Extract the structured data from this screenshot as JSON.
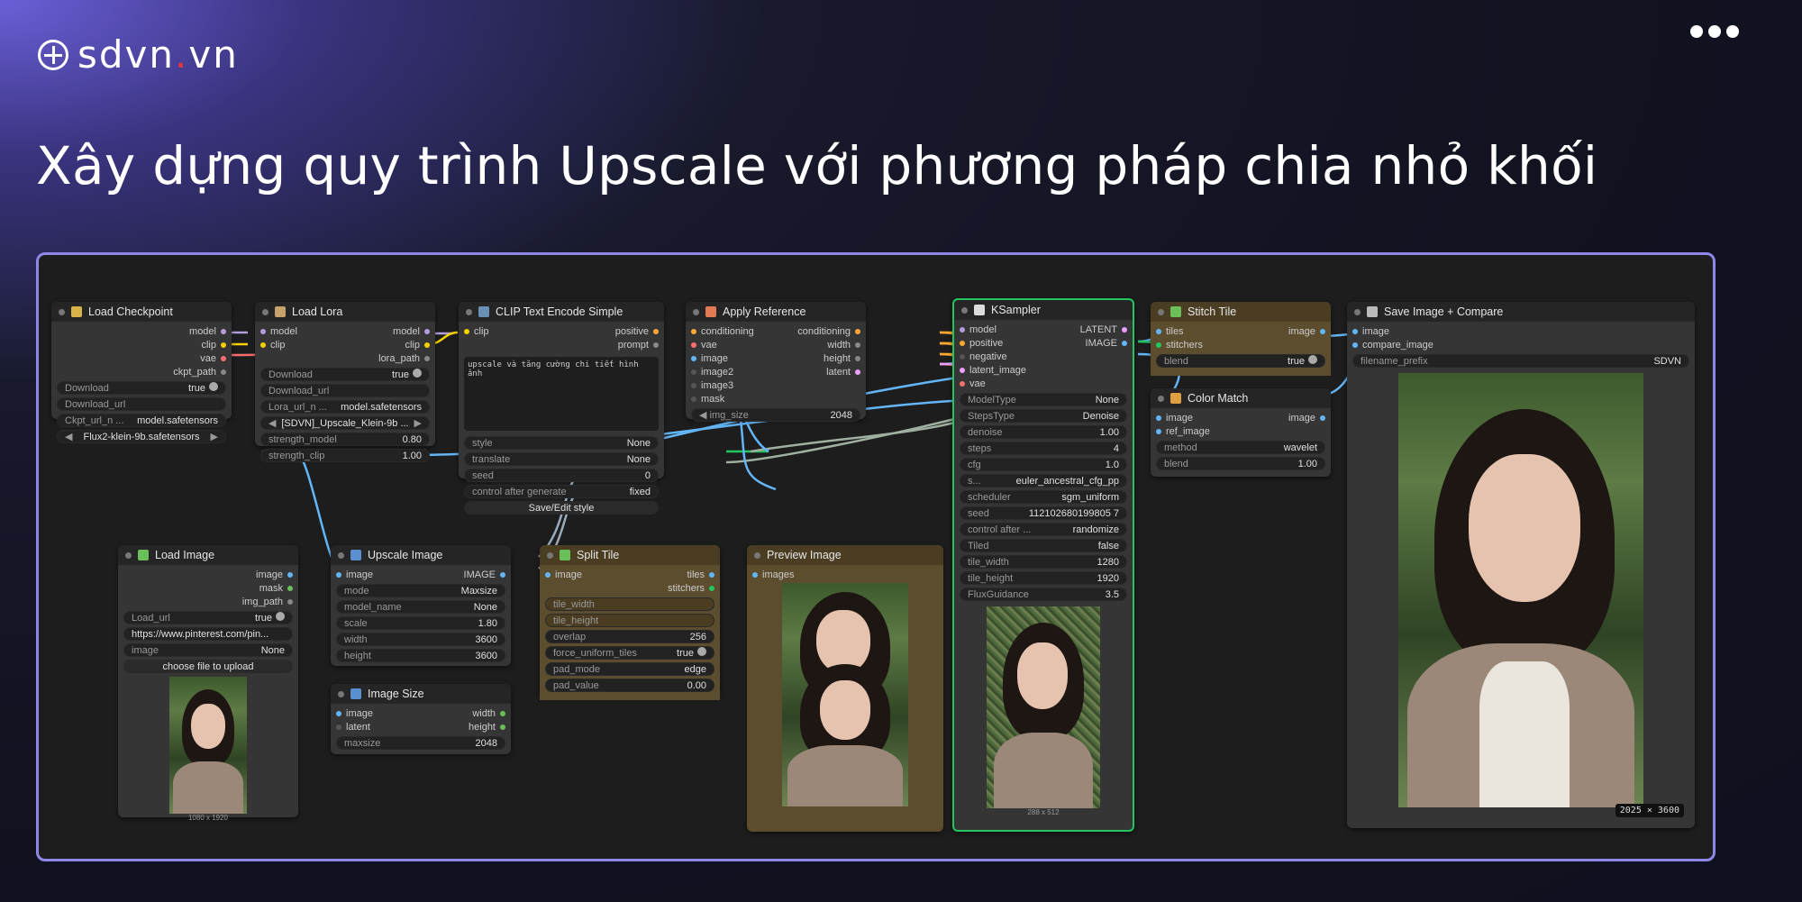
{
  "brand": {
    "name": "sdvn",
    "dot": ".",
    "tld": "vn"
  },
  "headline": "Xây dựng quy trình Upscale với phương pháp chia nhỏ khối",
  "nodes": {
    "load_checkpoint": {
      "title": "Load Checkpoint",
      "outputs": [
        "model",
        "clip",
        "vae",
        "ckpt_path"
      ],
      "widgets": [
        {
          "label": "Download",
          "value": "true"
        },
        {
          "label": "Download_url",
          "value": ""
        },
        {
          "label": "Ckpt_url_n ...",
          "value": "model.safetensors"
        },
        {
          "label": "",
          "value": "Flux2-klein-9b.safetensors"
        }
      ]
    },
    "load_lora": {
      "title": "Load Lora",
      "inputs": [
        "model",
        "clip"
      ],
      "outputs": [
        "model",
        "clip",
        "lora_path"
      ],
      "widgets": [
        {
          "label": "Download",
          "value": "true"
        },
        {
          "label": "Download_url",
          "value": ""
        },
        {
          "label": "Lora_url_n ...",
          "value": "model.safetensors"
        },
        {
          "label": "",
          "value": "[SDVN]_Upscale_Klein-9b ..."
        },
        {
          "label": "strength_model",
          "value": "0.80"
        },
        {
          "label": "strength_clip",
          "value": "1.00"
        }
      ]
    },
    "clip_text": {
      "title": "CLIP Text Encode Simple",
      "inputs": [
        "clip"
      ],
      "outputs": [
        "positive",
        "prompt"
      ],
      "text": "upscale và tăng cường chi tiết hình ảnh",
      "widgets": [
        {
          "label": "style",
          "value": "None"
        },
        {
          "label": "translate",
          "value": "None"
        },
        {
          "label": "seed",
          "value": "0"
        },
        {
          "label": "control after generate",
          "value": "fixed"
        }
      ],
      "button": "Save/Edit style"
    },
    "apply_reference": {
      "title": "Apply Reference",
      "inputs": [
        "conditioning",
        "vae",
        "image",
        "image2",
        "image3",
        "mask"
      ],
      "outputs": [
        "conditioning",
        "width",
        "height",
        "latent"
      ],
      "widgets": [
        {
          "label": "img_size",
          "value": "2048"
        }
      ]
    },
    "ksampler": {
      "title": "KSampler",
      "inputs": [
        "model",
        "positive",
        "negative",
        "latent_image",
        "vae"
      ],
      "outputs": [
        "LATENT",
        "IMAGE"
      ],
      "widgets": [
        {
          "label": "ModelType",
          "value": "None"
        },
        {
          "label": "StepsType",
          "value": "Denoise"
        },
        {
          "label": "denoise",
          "value": "1.00"
        },
        {
          "label": "steps",
          "value": "4"
        },
        {
          "label": "cfg",
          "value": "1.0"
        },
        {
          "label": "s...",
          "value": "euler_ancestral_cfg_pp"
        },
        {
          "label": "scheduler",
          "value": "sgm_uniform"
        },
        {
          "label": "seed",
          "value": "112102680199805 7"
        },
        {
          "label": "control after ...",
          "value": "randomize"
        },
        {
          "label": "Tiled",
          "value": "false"
        },
        {
          "label": "tile_width",
          "value": "1280"
        },
        {
          "label": "tile_height",
          "value": "1920"
        },
        {
          "label": "FluxGuidance",
          "value": "3.5"
        }
      ],
      "caption": "288 x 512"
    },
    "stitch_tile": {
      "title": "Stitch Tile",
      "inputs": [
        "tiles",
        "stitchers"
      ],
      "outputs": [
        "image"
      ],
      "widgets": [
        {
          "label": "blend",
          "value": "true"
        }
      ]
    },
    "color_match": {
      "title": "Color Match",
      "inputs": [
        "image",
        "ref_image"
      ],
      "outputs": [
        "image"
      ],
      "widgets": [
        {
          "label": "method",
          "value": "wavelet"
        },
        {
          "label": "blend",
          "value": "1.00"
        }
      ]
    },
    "save_image": {
      "title": "Save Image + Compare",
      "inputs": [
        "image",
        "compare_image"
      ],
      "widgets": [
        {
          "label": "filename_prefix",
          "value": "SDVN"
        }
      ],
      "badge": "2025 × 3600"
    },
    "load_image": {
      "title": "Load Image",
      "outputs": [
        "image",
        "mask",
        "img_path"
      ],
      "widgets": [
        {
          "label": "Load_url",
          "value": "true"
        },
        {
          "label": "",
          "value": "https://www.pinterest.com/pin..."
        },
        {
          "label": "image",
          "value": "None"
        }
      ],
      "button": "choose file to upload",
      "caption": "1080 x 1920"
    },
    "upscale_image": {
      "title": "Upscale Image",
      "inputs": [
        "image"
      ],
      "outputs": [
        "IMAGE"
      ],
      "widgets": [
        {
          "label": "mode",
          "value": "Maxsize"
        },
        {
          "label": "model_name",
          "value": "None"
        },
        {
          "label": "scale",
          "value": "1.80"
        },
        {
          "label": "width",
          "value": "3600"
        },
        {
          "label": "height",
          "value": "3600"
        }
      ]
    },
    "image_size": {
      "title": "Image Size",
      "inputs": [
        "image",
        "latent"
      ],
      "outputs": [
        "width",
        "height"
      ],
      "widgets": [
        {
          "label": "maxsize",
          "value": "2048"
        }
      ]
    },
    "split_tile": {
      "title": "Split Tile",
      "inputs": [
        "image"
      ],
      "outputs": [
        "tiles",
        "stitchers"
      ],
      "widgets": [
        {
          "label": "tile_width",
          "value": ""
        },
        {
          "label": "tile_height",
          "value": ""
        },
        {
          "label": "overlap",
          "value": "256"
        },
        {
          "label": "force_uniform_tiles",
          "value": "true"
        },
        {
          "label": "pad_mode",
          "value": "edge"
        },
        {
          "label": "pad_value",
          "value": "0.00"
        }
      ]
    },
    "preview_image": {
      "title": "Preview Image",
      "inputs": [
        "images"
      ]
    }
  },
  "colors": {
    "accent": "#8f87e8",
    "selected": "#22c55e",
    "socket_image": "#64b5f6",
    "socket_clip": "#f5d100",
    "socket_vae": "#ff6e6e",
    "socket_model": "#b39ddb",
    "socket_cond": "#ffa931"
  }
}
